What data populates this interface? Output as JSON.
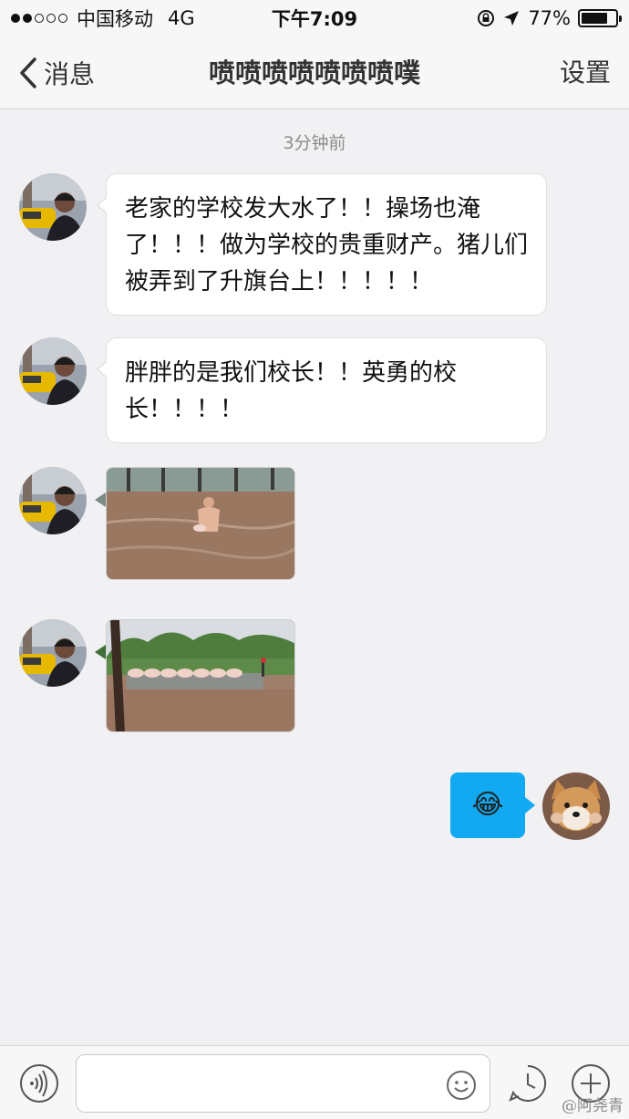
{
  "status_bar": {
    "carrier": "中国移动",
    "network": "4G",
    "time": "下午7:09",
    "battery_percent": "77%",
    "battery_level": 0.77,
    "signal_bars_filled": 2,
    "signal_bars_total": 5
  },
  "nav": {
    "back_label": "消息",
    "title": "喷喷喷喷喷喷喷噗",
    "settings_label": "设置"
  },
  "timestamp": "3分钟前",
  "messages": [
    {
      "type": "text",
      "side": "left",
      "text": "老家的学校发大水了！！操场也淹了！！！做为学校的贵重财产。猪儿们被弄到了升旗台上！！！！！"
    },
    {
      "type": "text",
      "side": "left",
      "text": "胖胖的是我们校长！！英勇的校长！！！！"
    },
    {
      "type": "image",
      "side": "left",
      "description": "flood-photo-man"
    },
    {
      "type": "image",
      "side": "left",
      "description": "flood-photo-pigs"
    },
    {
      "type": "emoji",
      "side": "right",
      "emoji": "😂"
    }
  ],
  "input_bar": {
    "placeholder": ""
  },
  "watermark": "@阿尧青",
  "colors": {
    "accent": "#12a9f2",
    "background": "#f1f1f3"
  }
}
